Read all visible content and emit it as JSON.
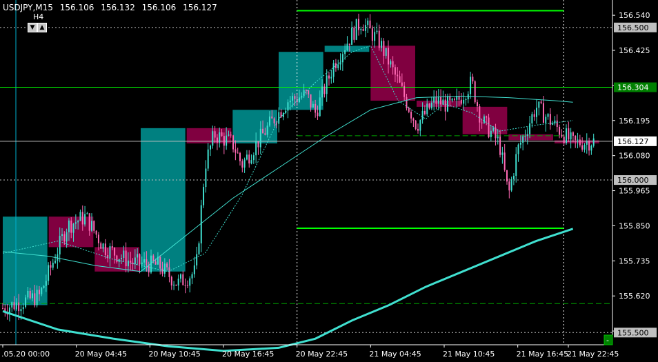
{
  "header": {
    "symbol_tf": "USDJPY,M15",
    "open": "156.106",
    "high": "156.132",
    "low": "156.106",
    "close": "156.127"
  },
  "panel": {
    "tf_label": "H4",
    "down_arrow": "▼",
    "up_arrow": "▲"
  },
  "corner_button": "-",
  "colors": {
    "background": "#000000",
    "bull_candle": "#40e0d0",
    "bear_candle": "#ff69b4",
    "bull_zone": "#008080",
    "bear_zone": "#800040",
    "level_line": "#00ff00",
    "ma_line": "#40e0d0",
    "price_tag_green": "#008000",
    "price_tag_gray": "#c0c0c0"
  },
  "chart_data": {
    "type": "candlestick",
    "symbol": "USDJPY",
    "timeframe": "M15",
    "price_axis": {
      "range": [
        155.46,
        156.59
      ],
      "ticks": [
        "156.540",
        "156.425",
        "156.310",
        "156.195",
        "156.080",
        "155.965",
        "155.850",
        "155.735",
        "155.620",
        "155.505"
      ]
    },
    "time_axis": {
      "ticks": [
        ".05.20 00:00",
        "20 May 04:45",
        "20 May 10:45",
        "20 May 16:45",
        "20 May 22:45",
        "21 May 04:45",
        "21 May 10:45",
        "21 May 16:45",
        "21 May 22:45"
      ]
    },
    "price_tags": [
      {
        "value": "156.500",
        "style": "gray"
      },
      {
        "value": "156.304",
        "style": "green"
      },
      {
        "value": "156.127",
        "style": "current"
      },
      {
        "value": "156.000",
        "style": "gray"
      },
      {
        "value": "155.500",
        "style": "gray"
      }
    ],
    "horizontal_levels": [
      {
        "price": 156.304,
        "style": "solid",
        "color": "#00ff00",
        "extent": "full"
      },
      {
        "price": 156.5,
        "style": "dotted",
        "color": "#c0c0c0",
        "extent": "full"
      },
      {
        "price": 156.0,
        "style": "dotted",
        "color": "#c0c0c0",
        "extent": "full"
      },
      {
        "price": 155.5,
        "style": "dotted",
        "color": "#c0c0c0",
        "extent": "full"
      },
      {
        "price": 156.127,
        "style": "solid",
        "color": "#c0c0c0",
        "extent": "full"
      },
      {
        "price": 156.555,
        "style": "solid",
        "color": "#00ff00",
        "extent": "last-day"
      },
      {
        "price": 155.842,
        "style": "solid",
        "color": "#00ff00",
        "extent": "last-day"
      },
      {
        "price": 156.145,
        "style": "dashed",
        "color": "#00a000",
        "extent": "last-day"
      },
      {
        "price": 155.595,
        "style": "dashed",
        "color": "#00a000",
        "extent": "full"
      }
    ],
    "h4_zones": [
      {
        "t0": 0,
        "t1": 5,
        "open": 155.59,
        "close": 155.88
      },
      {
        "t0": 5,
        "t1": 10,
        "open": 155.88,
        "close": 155.78
      },
      {
        "t0": 10,
        "t1": 15,
        "open": 155.78,
        "close": 155.7
      },
      {
        "t0": 15,
        "t1": 20,
        "open": 155.7,
        "close": 156.17
      },
      {
        "t0": 20,
        "t1": 25,
        "open": 156.17,
        "close": 156.12
      },
      {
        "t0": 25,
        "t1": 30,
        "open": 156.12,
        "close": 156.23
      },
      {
        "t0": 30,
        "t1": 35,
        "open": 156.23,
        "close": 156.42
      },
      {
        "t0": 35,
        "t1": 40,
        "open": 156.42,
        "close": 156.44
      },
      {
        "t0": 40,
        "t1": 45,
        "open": 156.44,
        "close": 156.26
      },
      {
        "t0": 45,
        "t1": 50,
        "open": 156.26,
        "close": 156.24
      },
      {
        "t0": 50,
        "t1": 55,
        "open": 156.24,
        "close": 156.15
      },
      {
        "t0": 55,
        "t1": 60,
        "open": 156.15,
        "close": 156.13
      },
      {
        "t0": 60,
        "t1": 65,
        "open": 156.13,
        "close": 156.12
      }
    ],
    "ohlc_path": [
      [
        0,
        155.58
      ],
      [
        4,
        155.62
      ],
      [
        7,
        155.85
      ],
      [
        9,
        155.88
      ],
      [
        11,
        155.78
      ],
      [
        14,
        155.73
      ],
      [
        17,
        155.72
      ],
      [
        19,
        155.66
      ],
      [
        21,
        155.7
      ],
      [
        22,
        156.05
      ],
      [
        23,
        156.15
      ],
      [
        25,
        156.12
      ],
      [
        26,
        156.05
      ],
      [
        29,
        156.18
      ],
      [
        31,
        156.26
      ],
      [
        33,
        156.28
      ],
      [
        34,
        156.22
      ],
      [
        36,
        156.38
      ],
      [
        38,
        156.48
      ],
      [
        39,
        156.52
      ],
      [
        41,
        156.45
      ],
      [
        43,
        156.32
      ],
      [
        45,
        156.18
      ],
      [
        47,
        156.26
      ],
      [
        49,
        156.24
      ],
      [
        51,
        156.32
      ],
      [
        52,
        156.2
      ],
      [
        54,
        156.12
      ],
      [
        55,
        155.95
      ],
      [
        56,
        156.1
      ],
      [
        58,
        156.24
      ],
      [
        60,
        156.18
      ],
      [
        62,
        156.12
      ],
      [
        64,
        156.127
      ]
    ],
    "ma_fast": [
      [
        0,
        155.76
      ],
      [
        6,
        155.8
      ],
      [
        12,
        155.74
      ],
      [
        18,
        155.7
      ],
      [
        22,
        155.76
      ],
      [
        26,
        155.95
      ],
      [
        30,
        156.2
      ],
      [
        34,
        156.32
      ],
      [
        38,
        156.42
      ],
      [
        40,
        156.44
      ],
      [
        43,
        156.26
      ],
      [
        46,
        156.2
      ],
      [
        48,
        156.25
      ],
      [
        51,
        156.22
      ],
      [
        54,
        156.16
      ],
      [
        58,
        156.18
      ],
      [
        62,
        156.195
      ]
    ],
    "ma_slow": [
      [
        0,
        155.765
      ],
      [
        5,
        155.75
      ],
      [
        10,
        155.72
      ],
      [
        15,
        155.7
      ],
      [
        20,
        155.82
      ],
      [
        25,
        155.94
      ],
      [
        30,
        156.04
      ],
      [
        35,
        156.14
      ],
      [
        40,
        156.23
      ],
      [
        45,
        156.27
      ],
      [
        50,
        156.275
      ],
      [
        55,
        156.27
      ],
      [
        60,
        156.26
      ],
      [
        62,
        156.255
      ]
    ],
    "ma_long": [
      [
        0,
        155.57
      ],
      [
        6,
        155.51
      ],
      [
        12,
        155.48
      ],
      [
        18,
        155.455
      ],
      [
        24,
        155.44
      ],
      [
        30,
        155.45
      ],
      [
        34,
        155.48
      ],
      [
        38,
        155.54
      ],
      [
        42,
        155.59
      ],
      [
        46,
        155.65
      ],
      [
        50,
        155.7
      ],
      [
        54,
        155.75
      ],
      [
        58,
        155.8
      ],
      [
        62,
        155.84
      ]
    ]
  }
}
